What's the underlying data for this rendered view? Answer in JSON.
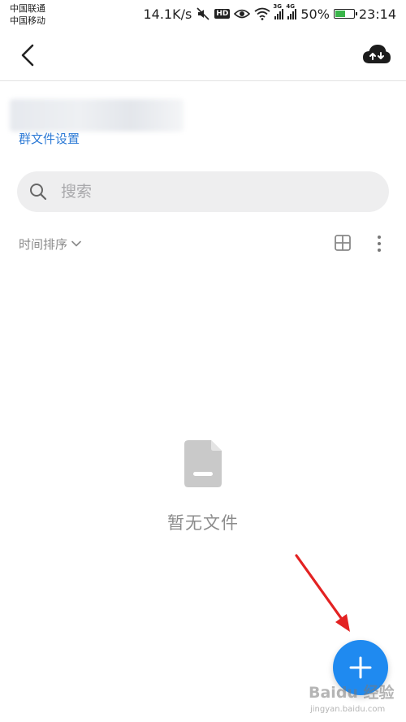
{
  "status_bar": {
    "carrier_1": "中国联通",
    "carrier_2": "中国移动",
    "net_speed": "14.1K/s",
    "hd_label": "HD",
    "signal_1_type": "3G",
    "signal_2_type": "4G",
    "battery_percent": "50%",
    "time": "23:14",
    "icons": [
      "mute-icon",
      "hd-icon",
      "eye-icon",
      "wifi-icon",
      "signal-icon",
      "battery-icon"
    ]
  },
  "nav": {
    "back_icon": "chevron-left-icon",
    "upload_icon": "cloud-upload-icon"
  },
  "group": {
    "settings_link": "群文件设置"
  },
  "search": {
    "placeholder": "搜索",
    "icon": "search-icon"
  },
  "toolbar": {
    "sort_label": "时间排序",
    "sort_icon": "chevron-down-icon",
    "view_icon": "grid-view-icon",
    "more_icon": "more-vertical-icon"
  },
  "empty_state": {
    "icon": "file-icon",
    "message": "暂无文件"
  },
  "fab": {
    "icon": "plus-icon",
    "color": "#1f8af0"
  },
  "watermark": {
    "main": "Baidu 经验",
    "sub": "jingyan.baidu.com"
  },
  "colors": {
    "accent": "#1f8af0",
    "link": "#2e7bd6",
    "annotation_arrow": "#e32222"
  }
}
